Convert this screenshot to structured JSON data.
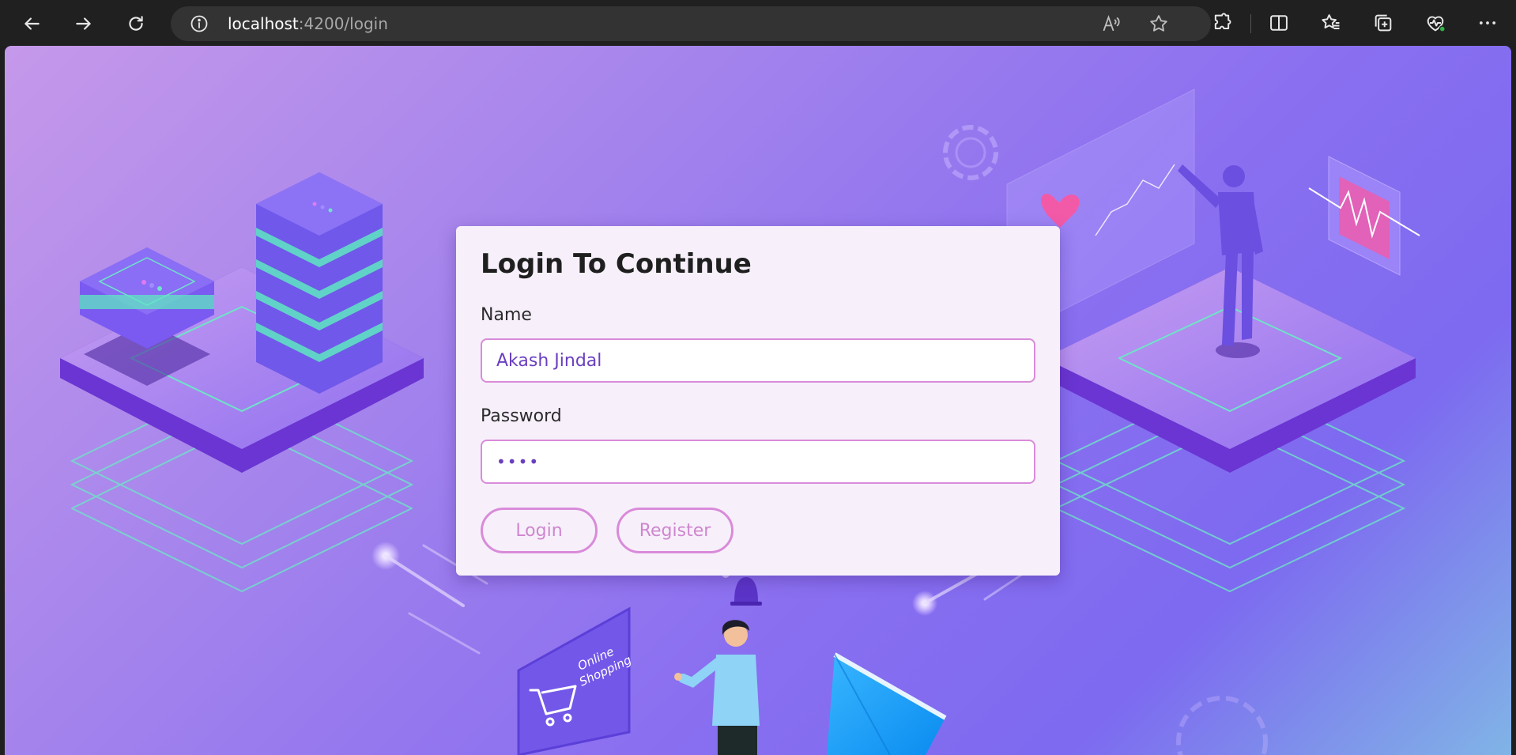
{
  "browser": {
    "url_host": "localhost",
    "url_path": ":4200/login",
    "nav": {
      "back_icon": "arrow-left-icon",
      "forward_icon": "arrow-right-icon",
      "refresh_icon": "refresh-icon"
    },
    "address_icons": [
      "info-icon",
      "read-aloud-icon",
      "favorite-star-icon"
    ],
    "toolbar_icons": [
      "extensions-icon",
      "split-screen-icon",
      "favorites-icon",
      "collections-icon",
      "browser-essentials-icon",
      "more-icon"
    ]
  },
  "login": {
    "title": "Login To Continue",
    "name_label": "Name",
    "name_value": "Akash Jindal",
    "password_label": "Password",
    "password_value": "••••",
    "login_button": "Login",
    "register_button": "Register"
  },
  "illustration": {
    "sign_line1": "Online",
    "sign_line2": "Shopping"
  },
  "colors": {
    "card_bg": "#f7f0fb",
    "accent_border": "#d98bd9",
    "input_text": "#6a3fc0",
    "bg_purple": "#8a6ff0"
  }
}
